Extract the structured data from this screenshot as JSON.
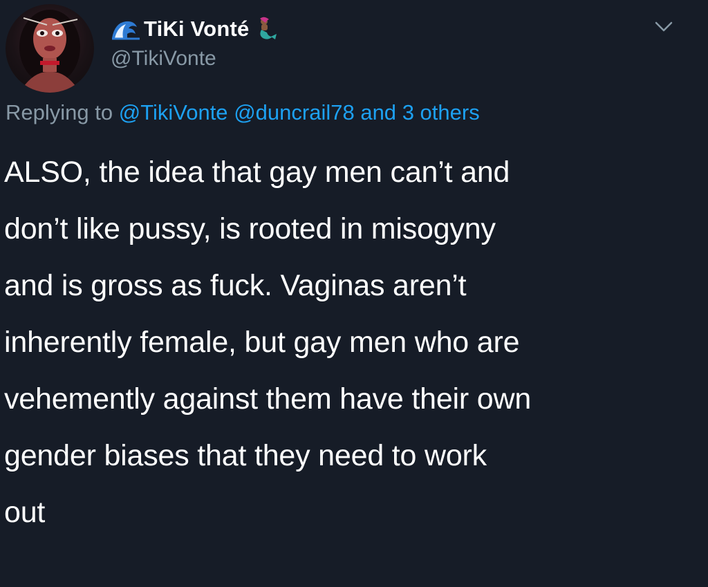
{
  "author": {
    "display_name": "TiKi Vonté",
    "handle": "@TikiVonte",
    "name_prefix_icon": "ocean-wave-icon",
    "name_suffix_icon": "mermaid-icon",
    "avatar": "profile-avatar"
  },
  "menu": {
    "icon": "chevron-down-icon"
  },
  "reply": {
    "prefix": "Replying to",
    "mentions": [
      "@TikiVonte",
      "@duncrail78"
    ],
    "connector": "and",
    "others": "3 others"
  },
  "tweet": {
    "text": "ALSO, the idea that gay men can’t and\ndon’t like pussy, is rooted in misogyny\nand is gross as fuck. Vaginas aren’t\ninherently female, but gay men who are\nvehemently against them have their own\ngender biases that they need to work\nout"
  },
  "colors": {
    "background": "#161c27",
    "text": "#ffffff",
    "secondary": "#8899a6",
    "link": "#1da1f2"
  }
}
